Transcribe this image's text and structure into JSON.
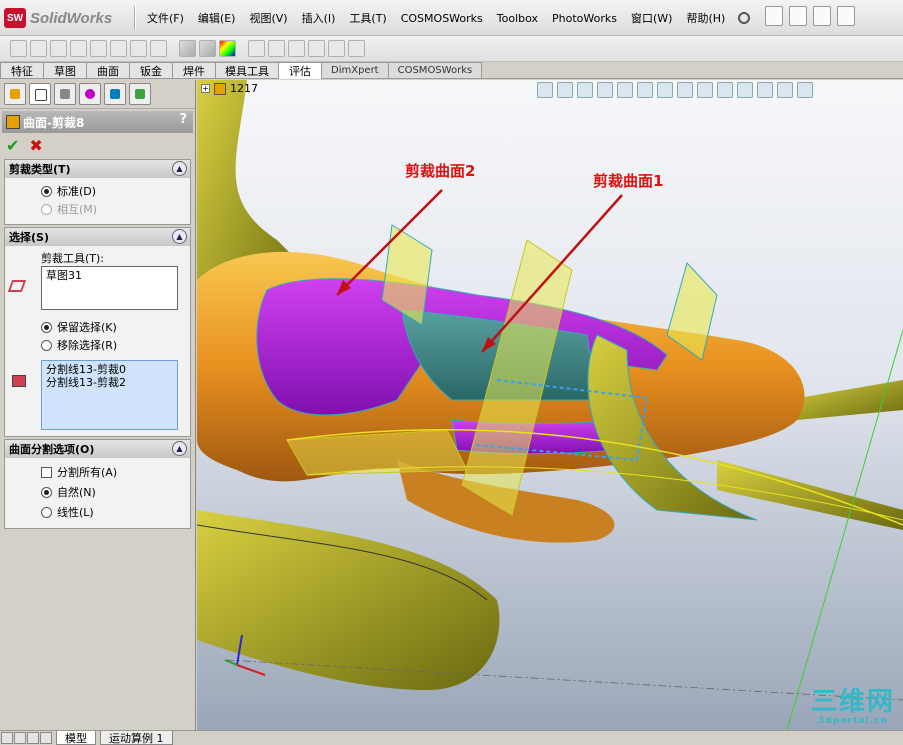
{
  "app": {
    "name": "SolidWorks",
    "logo_mark": "SW"
  },
  "menu": [
    {
      "label": "文件(F)"
    },
    {
      "label": "编辑(E)"
    },
    {
      "label": "视图(V)"
    },
    {
      "label": "插入(I)"
    },
    {
      "label": "工具(T)"
    },
    {
      "label": "COSMOSWorks"
    },
    {
      "label": "Toolbox"
    },
    {
      "label": "PhotoWorks"
    },
    {
      "label": "窗口(W)"
    },
    {
      "label": "帮助(H)"
    }
  ],
  "tabs": [
    {
      "label": "特征"
    },
    {
      "label": "草图"
    },
    {
      "label": "曲面"
    },
    {
      "label": "钣金"
    },
    {
      "label": "焊件"
    },
    {
      "label": "模具工具"
    },
    {
      "label": "评估"
    },
    {
      "label": "DimXpert"
    },
    {
      "label": "COSMOSWorks"
    }
  ],
  "feature": {
    "title": "曲面-剪裁8",
    "help": "?",
    "trim_type": {
      "header": "剪裁类型(T)",
      "options": [
        {
          "label": "标准(D)",
          "selected": true,
          "enabled": true
        },
        {
          "label": "相互(M)",
          "selected": false,
          "enabled": false
        }
      ]
    },
    "selection": {
      "header": "选择(S)",
      "trim_tool_label": "剪裁工具(T):",
      "trim_tool_value": "草图31",
      "options": [
        {
          "label": "保留选择(K)",
          "selected": true
        },
        {
          "label": "移除选择(R)",
          "selected": false
        }
      ],
      "faces": [
        "分割线13-剪裁0",
        "分割线13-剪裁2"
      ]
    },
    "split_options": {
      "header": "曲面分割选项(O)",
      "split_all": "分割所有(A)",
      "options": [
        {
          "label": "自然(N)",
          "selected": true
        },
        {
          "label": "线性(L)",
          "selected": false
        }
      ]
    }
  },
  "viewport": {
    "tree_count": "1217",
    "callouts": [
      "剪裁曲面2",
      "剪裁曲面1"
    ]
  },
  "bottom_tabs": [
    {
      "label": "模型"
    },
    {
      "label": "运动算例 1"
    }
  ],
  "watermark": {
    "main": "三维网",
    "sub": "3dportal.cn"
  },
  "colors": {
    "accent_red": "#e01010",
    "magenta_surface": "#b020e0",
    "gold_surface": "#e8a030",
    "yellow_sketch": "#e0e040",
    "teal_watermark": "#34b8c8"
  }
}
